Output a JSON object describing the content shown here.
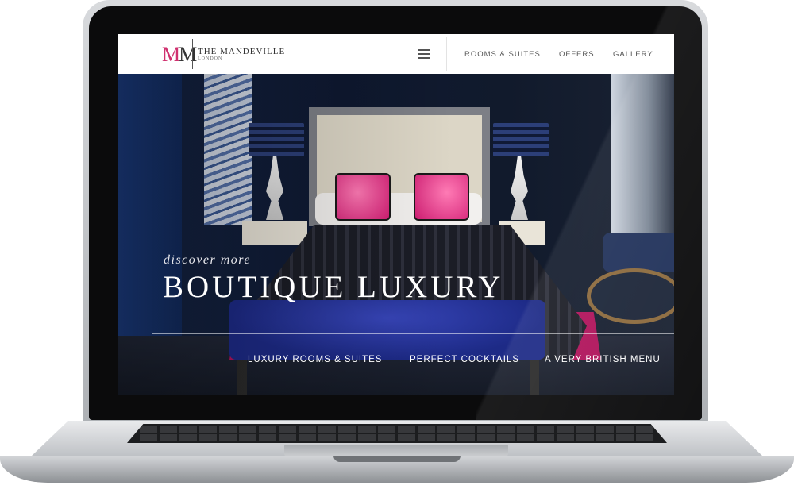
{
  "nav": {
    "logo_letter_a": "M",
    "logo_letter_b": "M",
    "brand_name": "THE MANDEVILLE",
    "brand_location": "LONDON",
    "links": [
      "ROOMS & SUITES",
      "OFFERS",
      "GALLERY"
    ],
    "menu_icon": "hamburger-icon"
  },
  "hero": {
    "eyebrow": "discover more",
    "title": "BOUTIQUE LUXURY",
    "features": [
      "LUXURY ROOMS & SUITES",
      "PERFECT COCKTAILS",
      "A VERY BRITISH MENU"
    ]
  },
  "colors": {
    "brand_accent": "#d0306f",
    "nav_background": "#ffffff",
    "hero_text": "#ffffff"
  }
}
